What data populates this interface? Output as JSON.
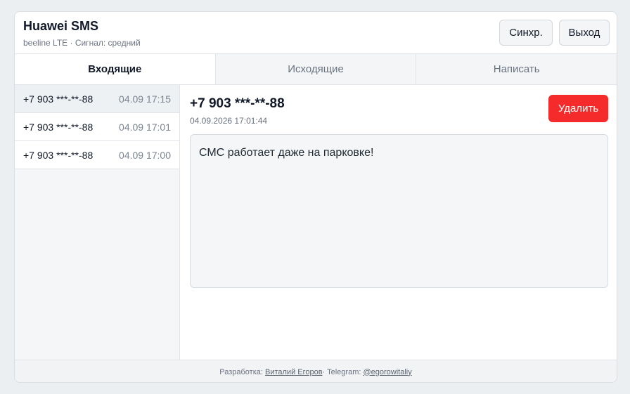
{
  "header": {
    "title": "Huawei SMS",
    "subtitle": "beeline LTE · Сигнал: средний",
    "sync_label": "Синхр.",
    "exit_label": "Выход"
  },
  "tabs": [
    {
      "label": "Входящие",
      "active": true
    },
    {
      "label": "Исходящие",
      "active": false
    },
    {
      "label": "Написать",
      "active": false
    }
  ],
  "messages": [
    {
      "phone": "+7 903 ***-**-88",
      "time": "04.09 17:15"
    },
    {
      "phone": "+7 903 ***-**-88",
      "time": "04.09 17:01"
    },
    {
      "phone": "+7 903 ***-**-88",
      "time": "04.09 17:00"
    }
  ],
  "detail": {
    "phone": "+7 903 ***-**-88",
    "date": "04.09.2026 17:01:44",
    "delete_label": "Удалить",
    "body": "СМС работает даже на парковке!"
  },
  "footer": {
    "dev_prefix": "Разработка: ",
    "dev_name": "Виталий Егоров",
    "tg_prefix": " · Telegram: ",
    "tg_handle": "@egorowitaliy"
  },
  "colors": {
    "accent_danger": "#f52a2a",
    "page_bg": "#eceff2"
  }
}
